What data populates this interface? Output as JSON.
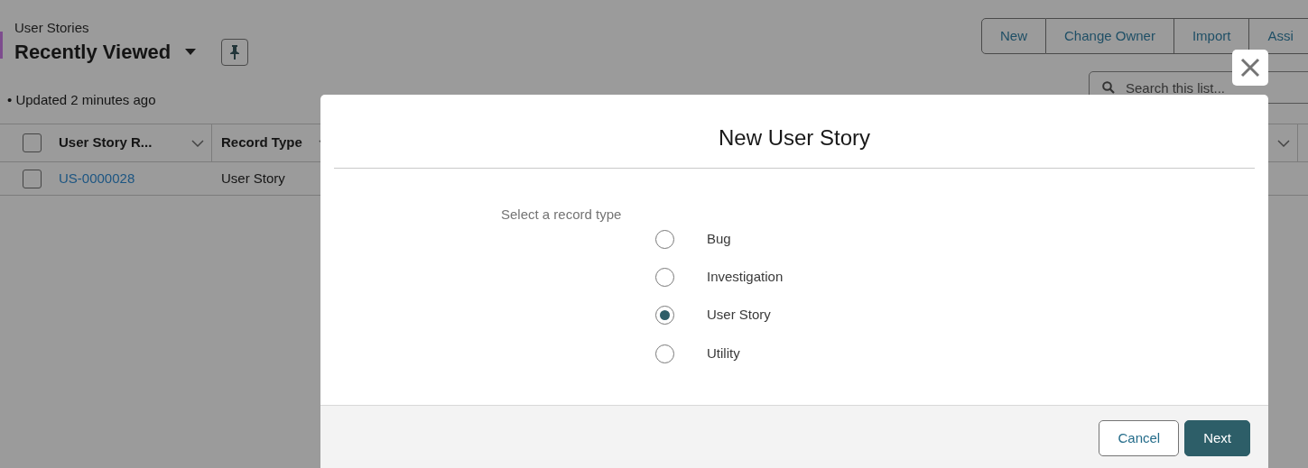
{
  "page": {
    "object_label": "User Stories",
    "list_view": "Recently Viewed",
    "status": "• Updated 2 minutes ago",
    "actions": [
      "New",
      "Change Owner",
      "Import",
      "Assi"
    ],
    "search": {
      "placeholder": "Search this list..."
    }
  },
  "table": {
    "select_all_checked": false,
    "columns": [
      "User Story R...",
      "Record Type"
    ],
    "rows": [
      {
        "checked": false,
        "cells": [
          "US-0000028",
          "User Story"
        ]
      }
    ]
  },
  "modal": {
    "title": "New User Story",
    "prompt": "Select a record type",
    "options": [
      {
        "label": "Bug",
        "selected": false
      },
      {
        "label": "Investigation",
        "selected": false
      },
      {
        "label": "User Story",
        "selected": true
      },
      {
        "label": "Utility",
        "selected": false
      }
    ],
    "buttons": [
      {
        "label": "Cancel",
        "kind": "neutral"
      },
      {
        "label": "Next",
        "kind": "brand"
      }
    ]
  }
}
